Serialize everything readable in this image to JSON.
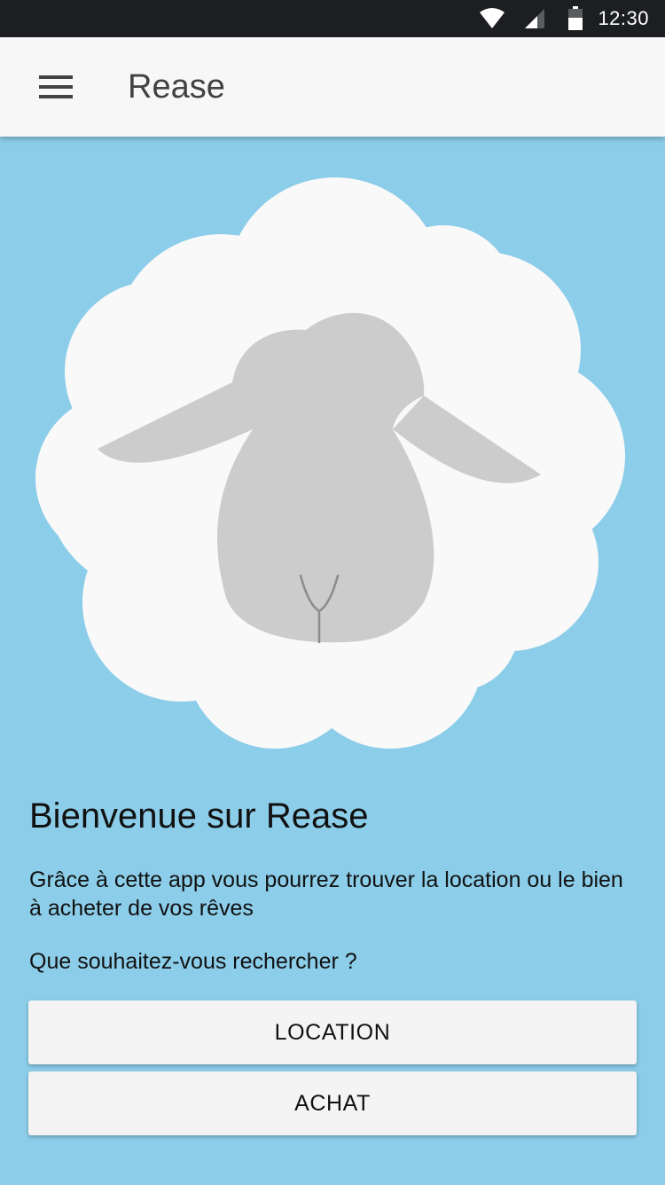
{
  "status_bar": {
    "time": "12:30",
    "icons": [
      "wifi-icon",
      "signal-icon",
      "battery-icon"
    ]
  },
  "app_bar": {
    "menu_icon": "menu-icon",
    "title": "Rease"
  },
  "illustration": {
    "description": "sheep-logo",
    "colors": {
      "background": "#8ccde9",
      "wool": "#f9f9f9",
      "face": "#cccccc",
      "nose": "#8c8c8c"
    }
  },
  "welcome": {
    "title": "Bienvenue sur Rease",
    "description": "Grâce à cette app vous pourrez trouver la location ou le bien à acheter de vos rêves",
    "question": "Que souhaitez-vous rechercher ?"
  },
  "buttons": {
    "location_label": "LOCATION",
    "achat_label": "ACHAT"
  },
  "colors": {
    "status_bar": "#1c1e22",
    "app_bar": "#f7f7f7",
    "background": "#8ccde9",
    "button": "#f4f4f4",
    "title_text": "#424242"
  }
}
